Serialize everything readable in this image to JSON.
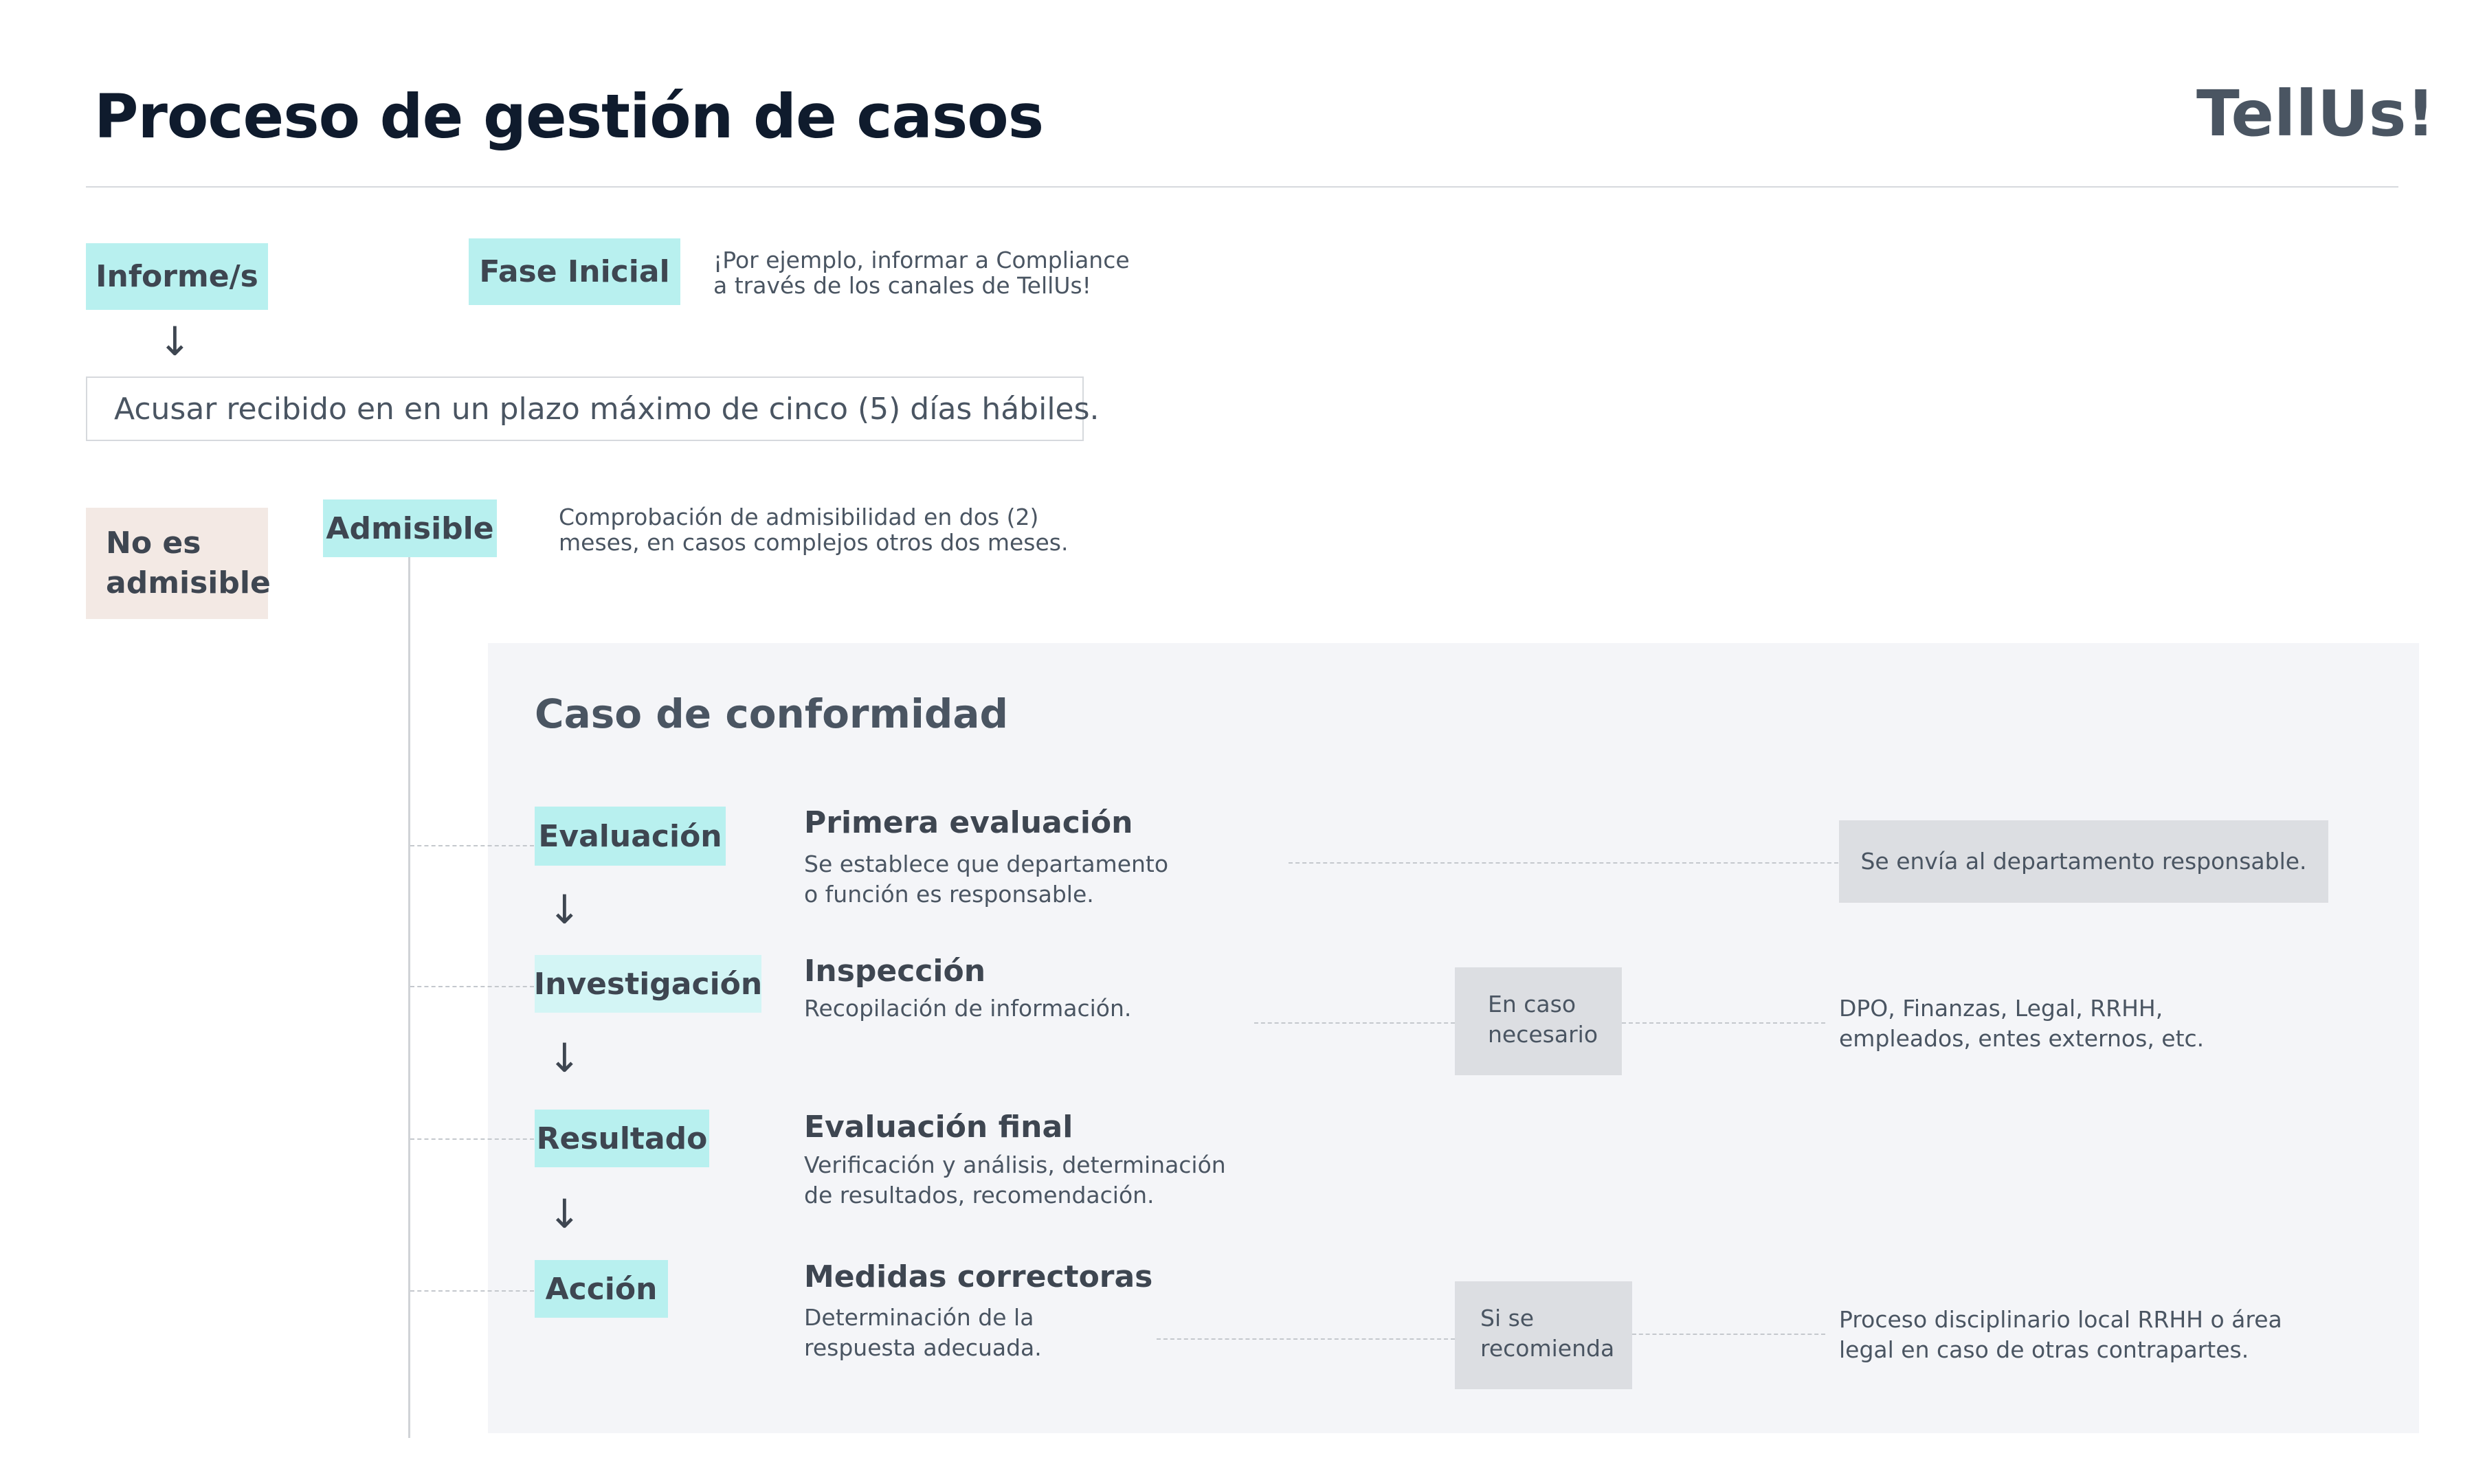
{
  "header": {
    "title": "Proceso de gestión de casos",
    "brand": "TellUs!"
  },
  "intake": {
    "report_tag": "Informe/s",
    "phase_tag": "Fase Inicial",
    "phase_note": [
      "¡Por ejemplo, informar a Compliance",
      "a través de los canales de TellUs!"
    ],
    "arrow": "↓",
    "acknowledge": "Acusar recibido en en un plazo máximo de cinco (5) días hábiles."
  },
  "admissibility": {
    "not_admissible": [
      "No es",
      "admisible"
    ],
    "admissible": "Admisible",
    "note": [
      "Comprobación de admisibilidad en dos (2)",
      "meses, en casos complejos otros dos meses."
    ]
  },
  "case": {
    "title": "Caso de conformidad",
    "arrow": "↓",
    "steps": [
      {
        "tag": "Evaluación",
        "title": "Primera evaluación",
        "desc": [
          "Se establece que departamento",
          "o función es responsable."
        ],
        "box": "Se envía al departamento responsable."
      },
      {
        "tag": "Investigación",
        "title": "Inspección",
        "desc": [
          "Recopilación de información."
        ],
        "condition": [
          "En caso",
          "necesario"
        ],
        "outcome": [
          "DPO, Finanzas, Legal, RRHH,",
          "empleados, entes externos, etc."
        ]
      },
      {
        "tag": "Resultado",
        "title": "Evaluación final",
        "desc": [
          "Verificación y análisis, determinación",
          "de resultados, recomendación."
        ]
      },
      {
        "tag": "Acción",
        "title": "Medidas correctoras",
        "desc": [
          "Determinación de la",
          "respuesta adecuada."
        ],
        "condition": [
          "Si se",
          "recomienda"
        ],
        "outcome": [
          "Proceso disciplinario local RRHH o área",
          "legal en caso de otras contrapartes."
        ]
      }
    ]
  }
}
